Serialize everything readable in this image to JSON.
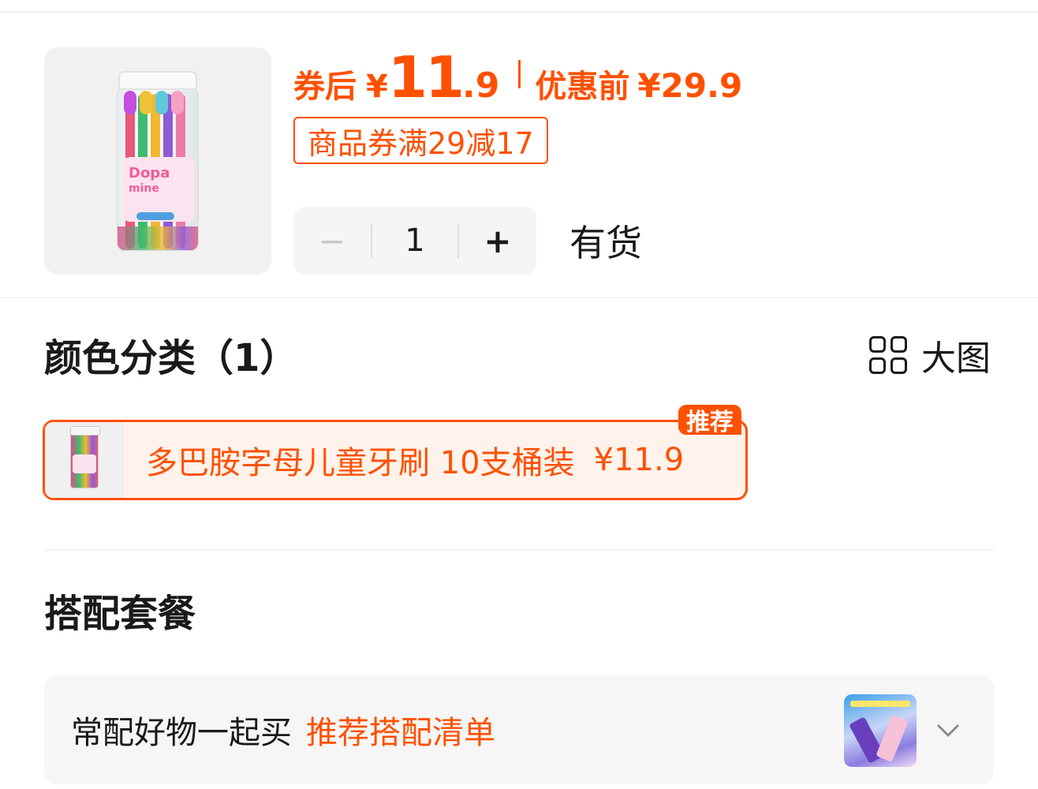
{
  "product": {
    "price_prefix": "券后",
    "currency": "¥",
    "price_int": "11",
    "price_dec": ".9",
    "orig_label": "优惠前",
    "orig_price": "¥29.9",
    "coupon_text": "商品券满29减17",
    "quantity": "1",
    "minus_symbol": "−",
    "plus_symbol": "+",
    "stock_status": "有货",
    "image_label_line1": "Dopa",
    "image_label_line2": "mine"
  },
  "color_section": {
    "title": "颜色分类（1）",
    "big_view_label": "大图",
    "options": [
      {
        "name": "多巴胺字母儿童牙刷 10支桶装",
        "price": "¥11.9",
        "badge": "推荐",
        "selected": true
      }
    ]
  },
  "bundle_section": {
    "title": "搭配套餐",
    "text": "常配好物一起买",
    "link": "推荐搭配清单"
  },
  "colors": {
    "accent": "#ff5000",
    "text": "#1a1a1a",
    "card_bg": "#f6f6f6"
  },
  "icons": {
    "grid": "grid-icon",
    "chevron": "chevron-down-icon"
  }
}
